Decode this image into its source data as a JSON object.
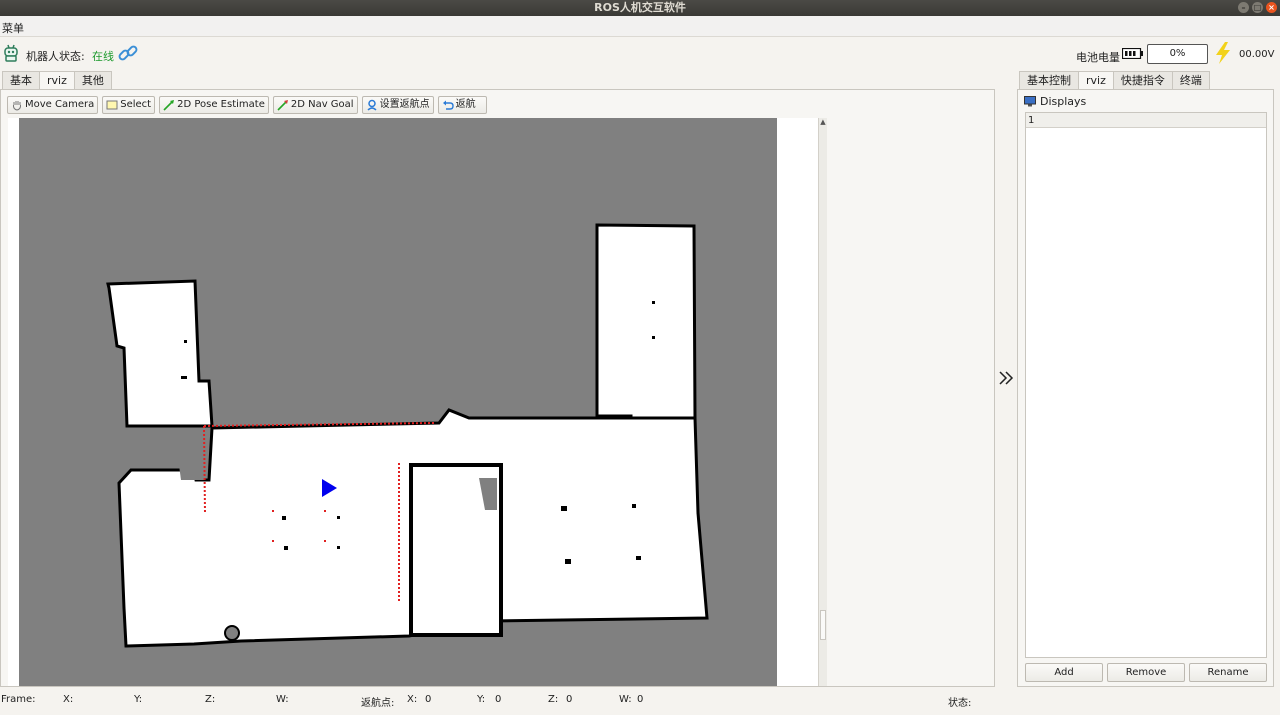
{
  "window": {
    "title": "ROS人机交互软件",
    "controls": [
      "minimize",
      "maximize",
      "close"
    ]
  },
  "menubar": {
    "menu_label": "菜单"
  },
  "status": {
    "robot_state_label": "机器人状态:",
    "robot_state_value": "在线",
    "battery_label": "电池电量",
    "battery_percent": "0%",
    "voltage": "00.00V"
  },
  "left_tabs": [
    "基本",
    "rviz",
    "其他"
  ],
  "left_active_tab": "rviz",
  "toolbar": {
    "move_camera": "Move Camera",
    "select": "Select",
    "pose_estimate": "2D Pose Estimate",
    "nav_goal": "2D Nav Goal",
    "set_return_point": "设置返航点",
    "return": "返航"
  },
  "right_tabs": [
    "基本控制",
    "rviz",
    "快捷指令",
    "终端"
  ],
  "right_active_tab": "rviz",
  "displays": {
    "title": "Displays",
    "tree_header": "1"
  },
  "panel_buttons": {
    "add": "Add",
    "remove": "Remove",
    "rename": "Rename"
  },
  "statusbar": {
    "frame": "Frame:",
    "x": "X:",
    "y": "Y:",
    "z": "Z:",
    "w": "W:",
    "return_point": "返航点:",
    "rp_x_label": "X:",
    "rp_x_value": "0",
    "rp_y_label": "Y:",
    "rp_y_value": "0",
    "rp_z_label": "Z:",
    "rp_z_value": "0",
    "rp_w_label": "W:",
    "rp_w_value": "0",
    "state": "状态:"
  },
  "colors": {
    "online": "#1e9a2e",
    "map_unknown": "#808080",
    "map_free": "#ffffff",
    "map_obstacle": "#000000",
    "laser_scan": "#e02020",
    "robot_arrow": "#0000ee",
    "bolt": "#f2d21b"
  }
}
